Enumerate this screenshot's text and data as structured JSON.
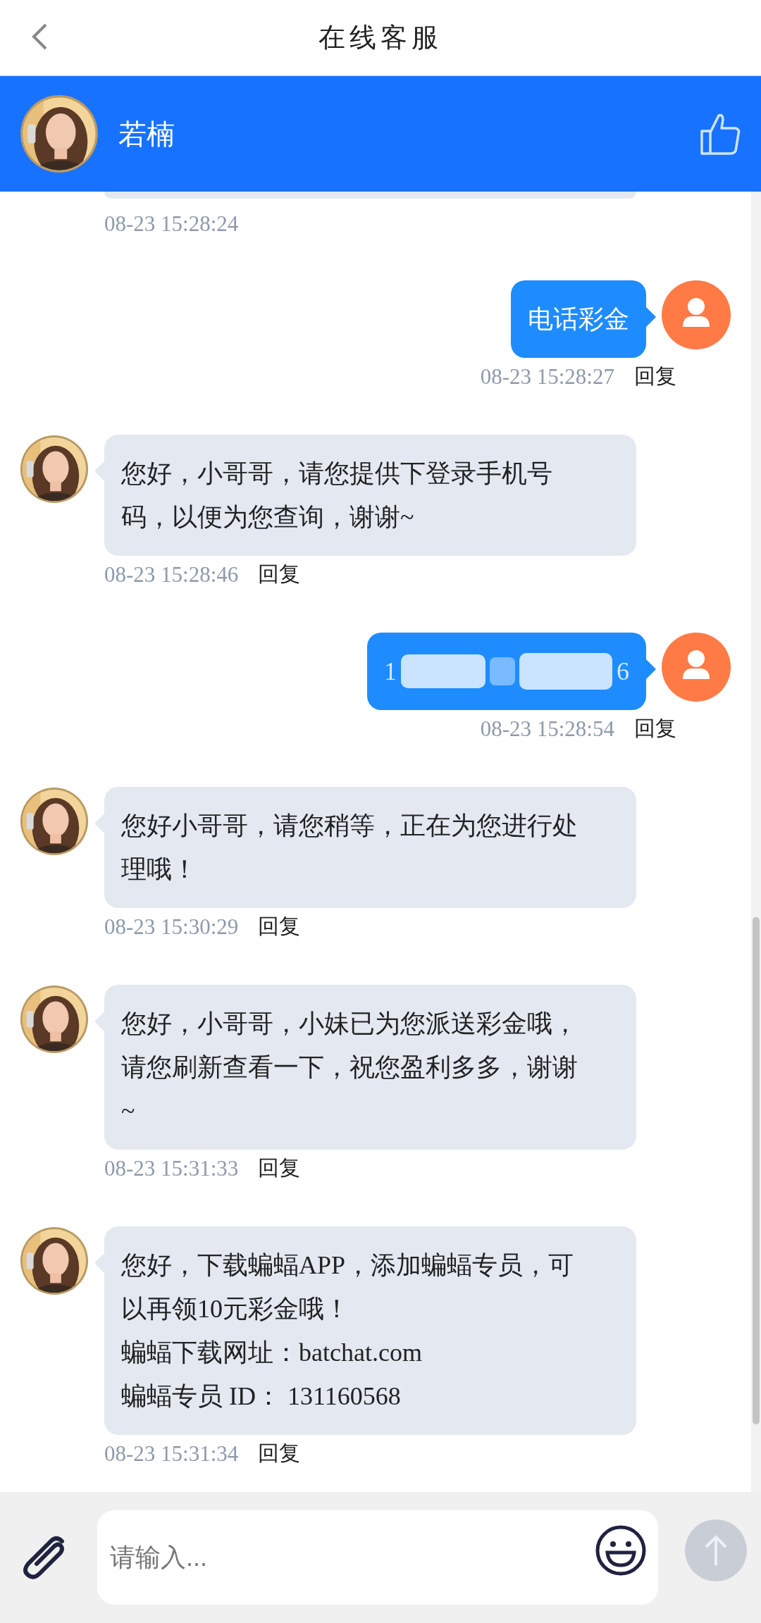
{
  "header": {
    "title": "在线客服"
  },
  "agent": {
    "name": "若楠"
  },
  "messages": [
    {
      "outgoing": false,
      "kind": "cut",
      "time": "08-23 15:28:24"
    },
    {
      "outgoing": true,
      "kind": "text",
      "lines": [
        "电话彩金"
      ],
      "time": "08-23 15:28:27",
      "reply": "回复"
    },
    {
      "outgoing": false,
      "kind": "text",
      "lines": [
        "您好，小哥哥，请您提供下登录手机号",
        "码，以便为您查询，谢谢~"
      ],
      "time": "08-23 15:28:46",
      "reply": "回复"
    },
    {
      "outgoing": true,
      "kind": "redacted",
      "fragments": [
        "1",
        "6"
      ],
      "time": "08-23 15:28:54",
      "reply": "回复"
    },
    {
      "outgoing": false,
      "kind": "text",
      "lines": [
        "您好小哥哥，请您稍等，正在为您进行处",
        "理哦！"
      ],
      "time": "08-23 15:30:29",
      "reply": "回复"
    },
    {
      "outgoing": false,
      "kind": "text",
      "lines": [
        "您好，小哥哥，小妹已为您派送彩金哦，",
        "请您刷新查看一下，祝您盈利多多，谢谢",
        "~"
      ],
      "time": "08-23 15:31:33",
      "reply": "回复"
    },
    {
      "outgoing": false,
      "kind": "text",
      "lines": [
        "您好，下载蝙蝠APP，添加蝙蝠专员，可",
        "以再领10元彩金哦！",
        "蝙蝠下载网址：batchat.com",
        "蝙蝠专员 ID：  131160568"
      ],
      "time": "08-23 15:31:34",
      "reply": "回复"
    }
  ],
  "composer": {
    "placeholder": "请输入..."
  }
}
